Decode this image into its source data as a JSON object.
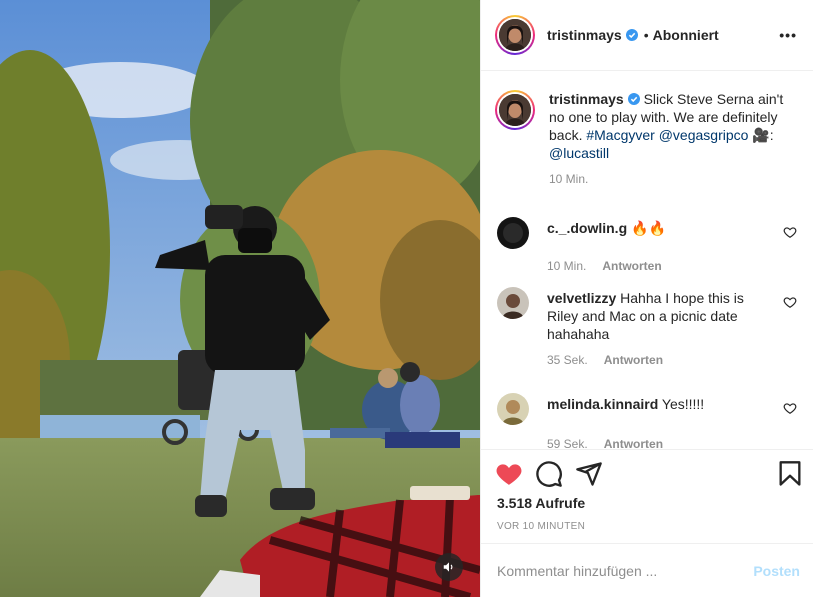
{
  "header": {
    "username": "tristinmays",
    "separator": "•",
    "follow_status": "Abonniert",
    "more_label": "•••"
  },
  "caption": {
    "username": "tristinmays",
    "text_pre": " Slick Steve Serna ain't no one to play with. We are definitely back. ",
    "hashtag": "#Macgyver",
    "space1": " ",
    "mention1": "@vegasgripco",
    "emoji": " 🎥:",
    "space2": " ",
    "mention2": "@lucastill",
    "time": "10 Min."
  },
  "comments": [
    {
      "username": "c._.dowlin.g",
      "text": " 🔥🔥",
      "time": "10 Min.",
      "reply": "Antworten"
    },
    {
      "username": "velvetlizzy",
      "text": " Hahha I hope this is Riley and Mac on a picnic date hahahaha",
      "time": "35 Sek.",
      "reply": "Antworten"
    },
    {
      "username": "melinda.kinnaird",
      "text": " Yes!!!!!",
      "time": "59 Sek.",
      "reply": "Antworten"
    }
  ],
  "stats": {
    "views": "3.518 Aufrufe",
    "timestamp": "VOR 10 MINUTEN",
    "liked": true
  },
  "composer": {
    "placeholder": "Kommentar hinzufügen ...",
    "post_label": "Posten"
  },
  "colors": {
    "like": "#ed4956",
    "link": "#00376b",
    "verified": "#3897f0",
    "post_disabled": "#b2dffc"
  },
  "icons": {
    "volume": "speaker-icon",
    "like": "heart-filled-icon",
    "comment": "comment-bubble-icon",
    "share": "paper-plane-icon",
    "save": "bookmark-icon"
  }
}
